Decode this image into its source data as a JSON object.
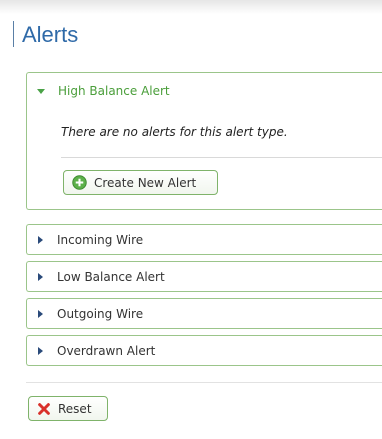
{
  "page": {
    "title": "Alerts"
  },
  "alert_types": [
    {
      "label": "High Balance Alert",
      "expanded": true
    },
    {
      "label": "Incoming Wire",
      "expanded": false
    },
    {
      "label": "Low Balance Alert",
      "expanded": false
    },
    {
      "label": "Outgoing Wire",
      "expanded": false
    },
    {
      "label": "Overdrawn Alert",
      "expanded": false
    }
  ],
  "expanded_panel": {
    "empty_message": "There are no alerts for this alert type.",
    "create_label": "Create New Alert"
  },
  "footer": {
    "reset_label": "Reset"
  },
  "colors": {
    "accent_green": "#4a9e3a",
    "title_blue": "#2f6aa8",
    "reset_red": "#d9312b"
  }
}
